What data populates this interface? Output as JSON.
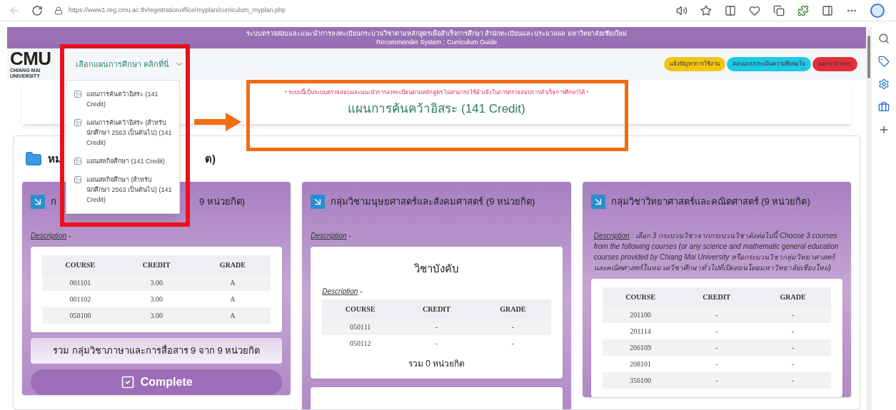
{
  "browser": {
    "url": "https://www1.reg.cmu.ac.th/registrationoffice/myplan/curriculum_myplan.php"
  },
  "header": {
    "line_1": "ระบบตรวจสอบและแนะนำการลงทะเบียนกระบวนวิชาตามหลักสูตรเพื่อสำเร็จการศึกษา สำนักทะเบียนและประมวลผล มหาวิทยาลัยเชียงใหม่",
    "line_2": "Recommender System : Curriculum Guide"
  },
  "nav": {
    "logo": "CMU",
    "logo_subtitle": "CHIANG MAI UNIVERSITY",
    "plan_dropdown": {
      "label": "เลือกแผนการศึกษา คลิกที่นี่",
      "expanded": true,
      "options": [
        {
          "label": "แผนการค้นคว้าอิสระ (141 Credit)"
        },
        {
          "label": "แผนการค้นคว้าอิสระ (สำหรับนักศึกษา 2563 เป็นต้นไป) (141 Credit)"
        },
        {
          "label": "แผนสหกิจศึกษา (141 Credit)"
        },
        {
          "label": "แผนสหกิจศึกษา (สำหรับนักศึกษา 2563 เป็นต้นไป) (141 Credit)"
        }
      ]
    },
    "buttons": [
      {
        "label": "แจ้งปัญหาการใช้งาน",
        "color": "#f2c417"
      },
      {
        "label": "ตอบแบบประเมินความพึงพอใจ",
        "color": "#1ec8e6"
      },
      {
        "label": "ออกจากระบบ",
        "color": "#e0303c"
      }
    ]
  },
  "notice": "* ระบบนี้เป็นระบบตรวจสอบและแนะนำการลงทะเบียนตามหลักสูตร ไม่สามารถใช้อ้างอิงในการตรวจสอบการสำเร็จการศึกษาได้ *",
  "plan_title": "แผนการค้นคว้าอิสระ (141 Credit)",
  "section": {
    "heading_parts": [
      "หม",
      "ต)"
    ]
  },
  "groups": [
    {
      "title_parts": [
        "ก",
        "9 หน่วยกิต)"
      ],
      "description_label": "Description",
      "description": "-",
      "more_panels_below": false,
      "panels": [
        {
          "table": {
            "columns": [
              "COURSE",
              "CREDIT",
              "GRADE"
            ],
            "rows": [
              [
                "001101",
                "3.00",
                "A"
              ],
              [
                "001102",
                "3.00",
                "A"
              ],
              [
                "050100",
                "3.00",
                "A"
              ]
            ]
          }
        }
      ],
      "total": "รวม กลุ่มวิชาภาษาและการสื่อสาร 9 จาก 9 หน่วยกิต",
      "status": "Complete"
    },
    {
      "title_parts": [
        "กลุ่มวิชามนุษยศาสตร์และสังคมศาสตร์ (9 หน่วยกิต)"
      ],
      "description_label": "Description",
      "description": "-",
      "more_panels_below": true,
      "panels": [
        {
          "heading": "วิชาบังคับ",
          "description_label": "Description",
          "description": "-",
          "table": {
            "columns": [
              "COURSE",
              "CREDIT",
              "GRADE"
            ],
            "rows": [
              [
                "050111",
                "-",
                "-"
              ],
              [
                "050112",
                "-",
                "-"
              ]
            ]
          },
          "total": "รวม 0 หน่วยกิต"
        }
      ]
    },
    {
      "title_parts": [
        "กลุ่มวิชาวิทยาศาสตร์และคณิตศาสตร์ (9 หน่วยกิต)"
      ],
      "description_label": "Description",
      "description": ": เลือก 3 กระบวนวิชาจากกระบวนวิชาดังต่อไปนี้ Choose 3 courses from the following courses (or any science and mathematic general education courses provided by Chiang Mai University หรือกระบวนวิชากลุ่มวิทยาศาสตร์และคณิตศาสตร์ในหมวดวิชาศึกษาทั่วไปที่เปิดสอนโดยมหาวิทยาลัยเชียงใหม่)",
      "more_panels_below": false,
      "panels": [
        {
          "table": {
            "columns": [
              "COURSE",
              "CREDIT",
              "GRADE"
            ],
            "rows": [
              [
                "201100",
                "-",
                "-"
              ],
              [
                "201114",
                "-",
                "-"
              ],
              [
                "206109",
                "-",
                "-"
              ],
              [
                "208101",
                "-",
                "-"
              ],
              [
                "356100",
                "-",
                "-"
              ]
            ]
          }
        }
      ]
    }
  ]
}
